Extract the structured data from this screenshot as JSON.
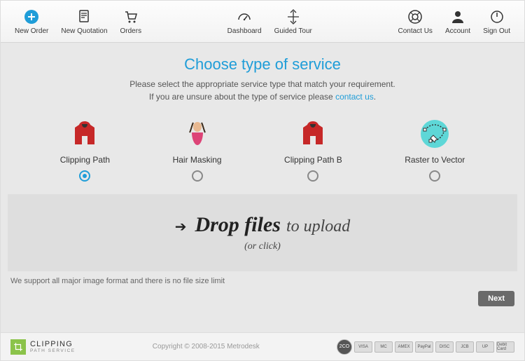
{
  "nav": {
    "left": [
      {
        "label": "New Order"
      },
      {
        "label": "New Quotation"
      },
      {
        "label": "Orders"
      }
    ],
    "mid": [
      {
        "label": "Dashboard"
      },
      {
        "label": "Guided Tour"
      }
    ],
    "right": [
      {
        "label": "Contact Us"
      },
      {
        "label": "Account"
      },
      {
        "label": "Sign Out"
      }
    ]
  },
  "main": {
    "title": "Choose type of service",
    "desc1": "Please select the appropriate service type that match your requirement.",
    "desc2_pre": "If you are unsure about the type of service please ",
    "desc2_link": "contact us",
    "desc2_post": "."
  },
  "services": [
    {
      "label": "Clipping Path",
      "selected": true
    },
    {
      "label": "Hair Masking",
      "selected": false
    },
    {
      "label": "Clipping Path B",
      "selected": false
    },
    {
      "label": "Raster to Vector",
      "selected": false
    }
  ],
  "dropzone": {
    "bold": "Drop files",
    "light": "to upload",
    "sub": "(or click)"
  },
  "support_text": "We support all major image format and there is no file size limit",
  "next_label": "Next",
  "footer": {
    "logo_main": "CLIPPING",
    "logo_sub": "PATH SERVICE",
    "copyright": "Copyright © 2008-2015 Metrodesk",
    "pay_badges": [
      "2CO",
      "VISA",
      "MC",
      "AMEX",
      "PayPal",
      "DISC",
      "JCB",
      "UP",
      "Debit Card"
    ]
  }
}
